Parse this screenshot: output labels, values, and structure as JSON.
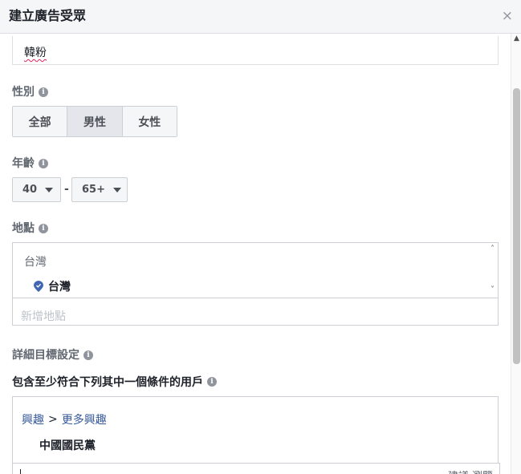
{
  "header": {
    "title": "建立廣告受眾",
    "close_glyph": "×"
  },
  "audience_name": {
    "value": "韓粉"
  },
  "gender": {
    "label": "性別",
    "options": [
      {
        "label": "全部",
        "selected": false
      },
      {
        "label": "男性",
        "selected": true
      },
      {
        "label": "女性",
        "selected": false
      }
    ]
  },
  "age": {
    "label": "年齡",
    "min": "40",
    "max": "65+",
    "separator": "-"
  },
  "location": {
    "label": "地點",
    "country": "台灣",
    "selected_item": "台灣",
    "placeholder": "新增地點"
  },
  "detailed_targeting": {
    "label": "詳細目標設定",
    "include_label": "包含至少符合下列其中一個條件的用戶",
    "breadcrumb": [
      "興趣",
      "更多興趣"
    ],
    "breadcrumb_separator": ">",
    "items": [
      "中國國民黨"
    ],
    "actions_label": "建議 瀏覽"
  },
  "icons": {
    "info": "info-icon",
    "pin": "location-pin-icon",
    "caret": "caret-down-icon"
  },
  "colors": {
    "link": "#365899",
    "pin": "#4267b2",
    "header_bg": "#f5f6f7"
  }
}
